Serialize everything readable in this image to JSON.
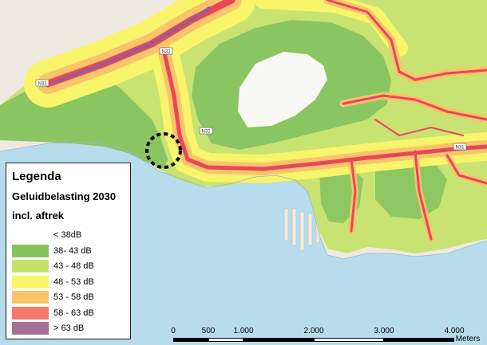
{
  "legend": {
    "title": "Legenda",
    "subtitle1": "Geluidbelasting 2030",
    "subtitle2": "incl. aftrek",
    "items": [
      {
        "label": "< 38dB",
        "color": "#ffffff"
      },
      {
        "label": "38- 43 dB",
        "color": "#86c35f"
      },
      {
        "label": "43 - 48 dB",
        "color": "#c5e36b"
      },
      {
        "label": "48 - 53 dB",
        "color": "#f8f56c"
      },
      {
        "label": "53 - 58 dB",
        "color": "#f9c46a"
      },
      {
        "label": "58 - 63 dB",
        "color": "#f57a6b"
      },
      {
        "label": "> 63 dB",
        "color": "#a3709a"
      }
    ]
  },
  "scale": {
    "ticks": [
      "0",
      "500",
      "1.000",
      "2.000",
      "3.000",
      "4.000"
    ],
    "unit": "Meters"
  },
  "road_labels": [
    "N32",
    "N32",
    "N32",
    "N31"
  ],
  "colors": {
    "water": "#b7dcec",
    "land": "#eeeae2"
  }
}
